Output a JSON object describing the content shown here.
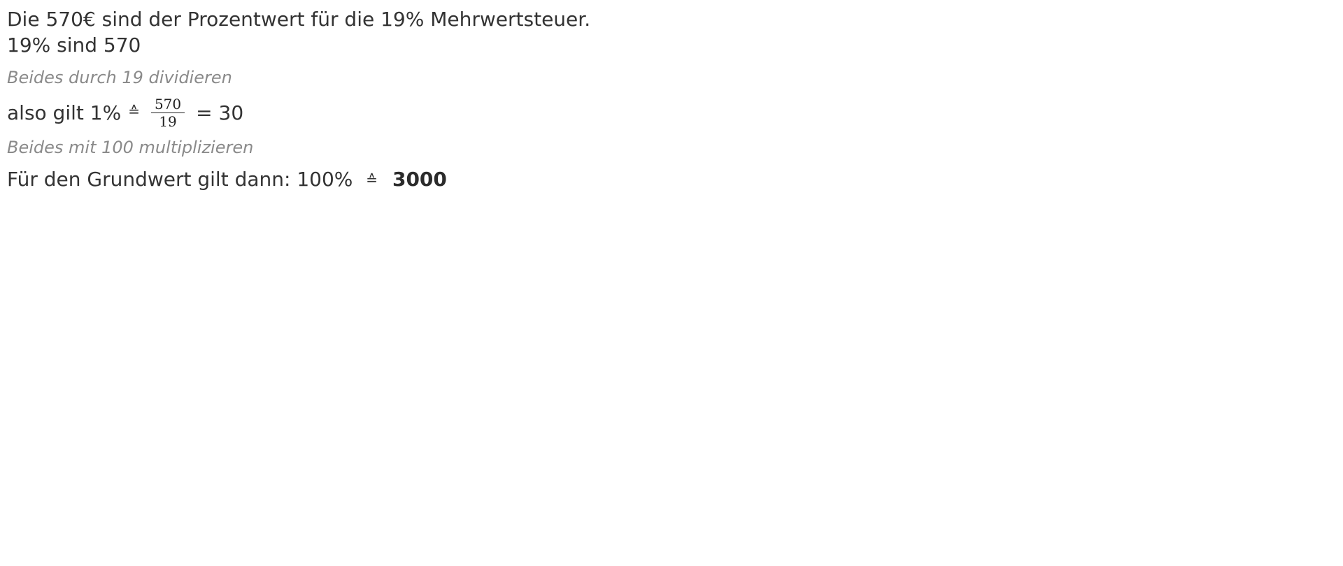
{
  "lines": {
    "intro": "Die 570€ sind der Prozentwert für die 19% Mehrwertsteuer.",
    "given": "19% sind 570",
    "hint_divide": "Beides durch 19 dividieren",
    "step1_prefix": "also gilt 1%",
    "step1_corresponds": "≙",
    "step1_numerator": "570",
    "step1_denominator": "19",
    "step1_result": "= 30",
    "hint_multiply": "Beides mit 100 multiplizieren",
    "final_prefix": "Für den Grundwert gilt dann: 100%",
    "final_corresponds": "≙",
    "final_result": "3000"
  }
}
